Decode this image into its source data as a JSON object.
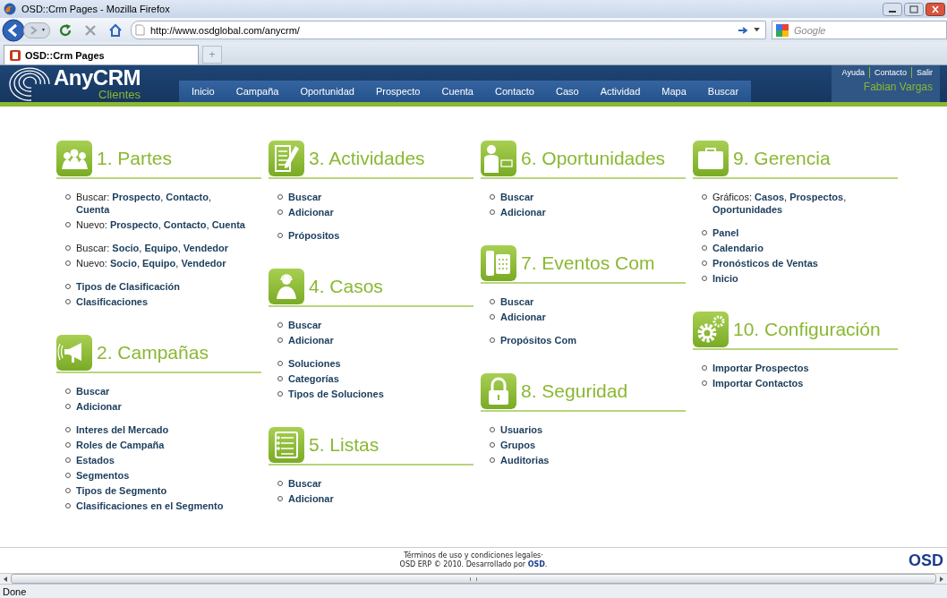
{
  "window": {
    "title": "OSD::Crm Pages - Mozilla Firefox"
  },
  "browser": {
    "url": "http://www.osdglobal.com/anycrm/",
    "search_placeholder": "Google",
    "tabs": [
      {
        "label": "OSD::Crm Pages",
        "selected": true
      }
    ],
    "new_tab": "+",
    "status": "Done"
  },
  "header": {
    "logo": "AnyCRM",
    "logo_sub": "Clientes",
    "nav": [
      {
        "label": "Inicio"
      },
      {
        "label": "Campaña"
      },
      {
        "label": "Oportunidad"
      },
      {
        "label": "Prospecto"
      },
      {
        "label": "Cuenta"
      },
      {
        "label": "Contacto"
      },
      {
        "label": "Caso"
      },
      {
        "label": "Actividad"
      },
      {
        "label": "Mapa"
      },
      {
        "label": "Buscar"
      }
    ],
    "top_links": [
      "Ayuda",
      "Contacto",
      "Salir"
    ],
    "user": "Fabian Vargas"
  },
  "columns": [
    [
      {
        "title": "1. Partes",
        "groups": [
          [
            {
              "kind": "mixed",
              "text": "Buscar: **Prospecto**, **Contacto**, **Cuenta**"
            },
            {
              "kind": "mixed",
              "text": "Nuevo: **Prospecto**, **Contacto**, **Cuenta**"
            }
          ],
          [
            {
              "kind": "mixed",
              "text": "Buscar: **Socio**, **Equipo**, **Vendedor**"
            },
            {
              "kind": "mixed",
              "text": "Nuevo: **Socio**, **Equipo**, **Vendedor**"
            }
          ],
          [
            {
              "kind": "link",
              "text": "Tipos de Clasificación"
            },
            {
              "kind": "link",
              "text": "Clasificaciones"
            }
          ]
        ]
      },
      {
        "title": "2. Campañas",
        "groups": [
          [
            {
              "kind": "link",
              "text": "Buscar"
            },
            {
              "kind": "link",
              "text": "Adicionar"
            }
          ],
          [
            {
              "kind": "link",
              "text": "Interes del Mercado"
            },
            {
              "kind": "link",
              "text": "Roles de Campaña"
            },
            {
              "kind": "link",
              "text": "Estados"
            },
            {
              "kind": "link",
              "text": "Segmentos"
            },
            {
              "kind": "link",
              "text": "Tipos de Segmento"
            },
            {
              "kind": "link",
              "text": "Clasificaciones en el Segmento"
            }
          ]
        ]
      }
    ],
    [
      {
        "title": "3. Actividades",
        "groups": [
          [
            {
              "kind": "link",
              "text": "Buscar"
            },
            {
              "kind": "link",
              "text": "Adicionar"
            }
          ],
          [
            {
              "kind": "link",
              "text": "Própositos"
            }
          ]
        ]
      },
      {
        "title": "4. Casos",
        "groups": [
          [
            {
              "kind": "link",
              "text": "Buscar"
            },
            {
              "kind": "link",
              "text": "Adicionar"
            }
          ],
          [
            {
              "kind": "link",
              "text": "Soluciones"
            },
            {
              "kind": "link",
              "text": "Categorías"
            },
            {
              "kind": "link",
              "text": "Tipos de Soluciones"
            }
          ]
        ]
      },
      {
        "title": "5. Listas",
        "groups": [
          [
            {
              "kind": "link",
              "text": "Buscar"
            },
            {
              "kind": "link",
              "text": "Adicionar"
            }
          ]
        ]
      }
    ],
    [
      {
        "title": "6. Oportunidades",
        "groups": [
          [
            {
              "kind": "link",
              "text": "Buscar"
            },
            {
              "kind": "link",
              "text": "Adicionar"
            }
          ]
        ]
      },
      {
        "title": "7. Eventos Com",
        "groups": [
          [
            {
              "kind": "link",
              "text": "Buscar"
            },
            {
              "kind": "link",
              "text": "Adicionar"
            }
          ],
          [
            {
              "kind": "link",
              "text": "Propósitos Com"
            }
          ]
        ]
      },
      {
        "title": "8. Seguridad",
        "groups": [
          [
            {
              "kind": "link",
              "text": "Usuarios"
            },
            {
              "kind": "link",
              "text": "Grupos"
            },
            {
              "kind": "link",
              "text": "Auditorias"
            }
          ]
        ]
      }
    ],
    [
      {
        "title": "9. Gerencia",
        "groups": [
          [
            {
              "kind": "mixed",
              "text": "Gráficos: **Casos**, **Prospectos**, **Oportunidades**"
            }
          ],
          [
            {
              "kind": "link",
              "text": "Panel"
            },
            {
              "kind": "link",
              "text": "Calendario"
            },
            {
              "kind": "link",
              "text": "Pronósticos de Ventas"
            },
            {
              "kind": "link",
              "text": "Inicio"
            }
          ]
        ]
      },
      {
        "title": "10. Configuración",
        "groups": [
          [
            {
              "kind": "link",
              "text": "Importar Prospectos"
            },
            {
              "kind": "link",
              "text": "Importar Contactos"
            }
          ]
        ]
      }
    ]
  ],
  "footer": {
    "terms": "Términos de uso y condiciones legales·",
    "copyright": "OSD ERP © 2010. Desarrollado por **OSD**.",
    "logo": "OSD"
  }
}
